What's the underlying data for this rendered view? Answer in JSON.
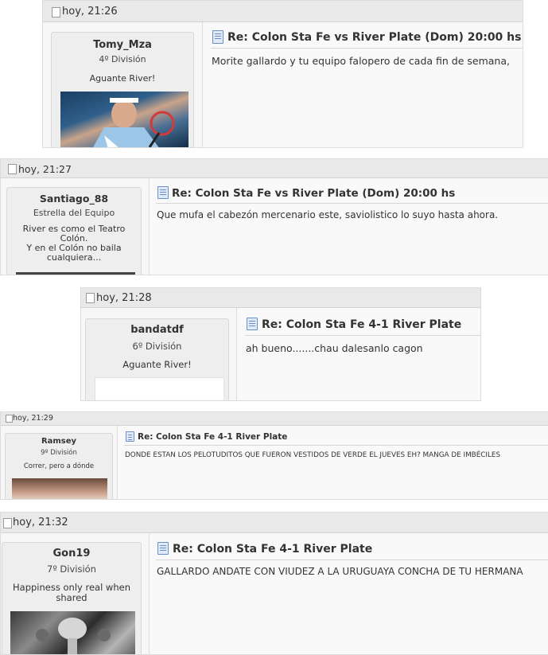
{
  "posts": [
    {
      "timestamp": "hoy, 21:26",
      "username": "Tomy_Mza",
      "rank": "4º División",
      "user_text": "Aguante River!",
      "title": "Re: Colon Sta Fe vs River Plate (Dom) 20:00 hs",
      "body": "Morite gallardo y tu equipo falopero de cada fin de semana,"
    },
    {
      "timestamp": "hoy, 21:27",
      "username": "Santiago_88",
      "rank": "Estrella del Equipo",
      "user_text_lines": [
        "River es como el Teatro",
        "Colón.",
        "Y en el Colón no baila",
        "cualquiera..."
      ],
      "title": "Re: Colon Sta Fe vs River Plate (Dom) 20:00 hs",
      "body": "Que mufa el cabezón mercenario este, saviolistico lo suyo hasta ahora."
    },
    {
      "timestamp": "hoy, 21:28",
      "username": "bandatdf",
      "rank": "6º División",
      "user_text": "Aguante River!",
      "title": "Re: Colon Sta Fe 4-1 River Plate",
      "body": "ah bueno.......chau dalesanlo cagon"
    },
    {
      "timestamp": "hoy, 21:29",
      "username": "Ramsey",
      "rank": "9º División",
      "user_text": "Correr, pero a dónde",
      "title": "Re: Colon Sta Fe 4-1 River Plate",
      "body": "DONDE ESTAN LOS PELOTUDITOS QUE FUERON VESTIDOS DE VERDE EL JUEVES EH? MANGA DE IMBÉCILES"
    },
    {
      "timestamp": "hoy, 21:32",
      "username": "Gon19",
      "rank": "7º División",
      "user_text_lines": [
        "Happiness only real when",
        "shared"
      ],
      "title": "Re: Colon Sta Fe 4-1 River Plate",
      "body": "GALLARDO ANDATE CON VIUDEZ A LA URUGUAYA CONCHA DE TU HERMANA"
    }
  ]
}
